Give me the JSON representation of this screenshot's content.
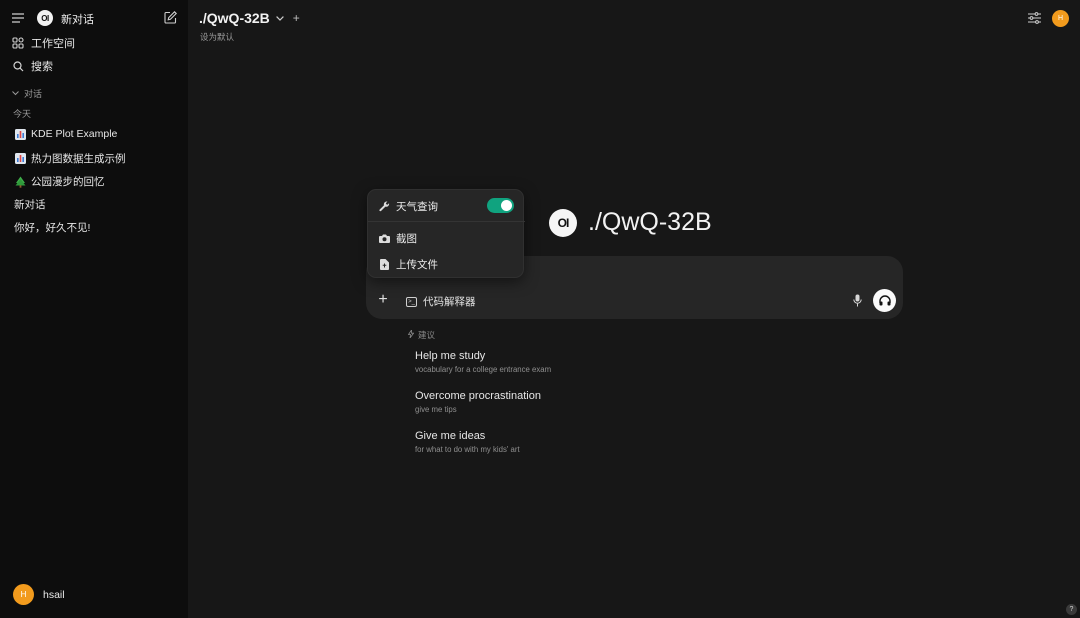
{
  "sidebar": {
    "logo_text": "OI",
    "new_chat_label": "新对话",
    "nav": [
      {
        "label": "工作空间",
        "icon": "grid-icon"
      },
      {
        "label": "搜索",
        "icon": "search-icon"
      }
    ],
    "section_label": "对话",
    "group_today": "今天",
    "chats": [
      {
        "label": "KDE Plot Example",
        "icon": "bar-chart-icon"
      },
      {
        "label": "热力图数据生成示例",
        "icon": "bar-chart-icon"
      },
      {
        "label": "公园漫步的回忆",
        "icon": "tree-icon"
      },
      {
        "label": "新对话",
        "icon": ""
      },
      {
        "label": "你好，好久不见!",
        "icon": ""
      }
    ],
    "user": {
      "avatar_initial": "H",
      "name": "hsail"
    }
  },
  "header": {
    "model_name": "./QwQ-32B",
    "add_model": "+",
    "set_default": "设为默认",
    "avatar_initial": "H"
  },
  "hero": {
    "logo_text": "OI",
    "title": "./QwQ-32B"
  },
  "composer": {
    "placeholder": "",
    "add_label": "+",
    "code_tool_label": "代码解释器"
  },
  "popover": {
    "items": [
      {
        "label": "天气查询",
        "icon": "wrench-icon",
        "toggle_on": true
      },
      {
        "label": "截图",
        "icon": "camera-icon"
      },
      {
        "label": "上传文件",
        "icon": "file-icon"
      }
    ]
  },
  "suggestions": {
    "header": "建议",
    "items": [
      {
        "title": "Help me study",
        "subtitle": "vocabulary for a college entrance exam"
      },
      {
        "title": "Overcome procrastination",
        "subtitle": "give me tips"
      },
      {
        "title": "Give me ideas",
        "subtitle": "for what to do with my kids' art"
      }
    ]
  },
  "help_label": "?",
  "colors": {
    "accent_toggle": "#10a37f",
    "avatar": "#f29b1d"
  }
}
